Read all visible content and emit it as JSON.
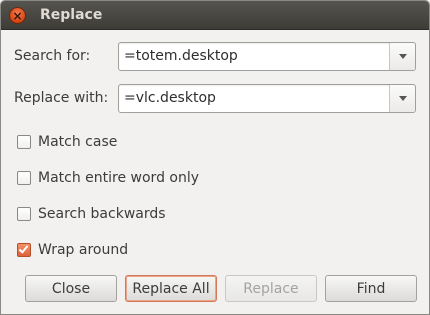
{
  "window": {
    "title": "Replace"
  },
  "search": {
    "label": "Search for:",
    "value": "=totem.desktop"
  },
  "replace": {
    "label": "Replace with:",
    "value": "=vlc.desktop"
  },
  "options": [
    {
      "label": "Match case",
      "checked": false
    },
    {
      "label": "Match entire word only",
      "checked": false
    },
    {
      "label": "Search backwards",
      "checked": false
    },
    {
      "label": "Wrap around",
      "checked": true
    }
  ],
  "buttons": {
    "close": "Close",
    "replace_all": "Replace All",
    "replace": "Replace",
    "find": "Find"
  },
  "colors": {
    "accent": "#e0603a",
    "titlebar": "#3d3c37"
  }
}
